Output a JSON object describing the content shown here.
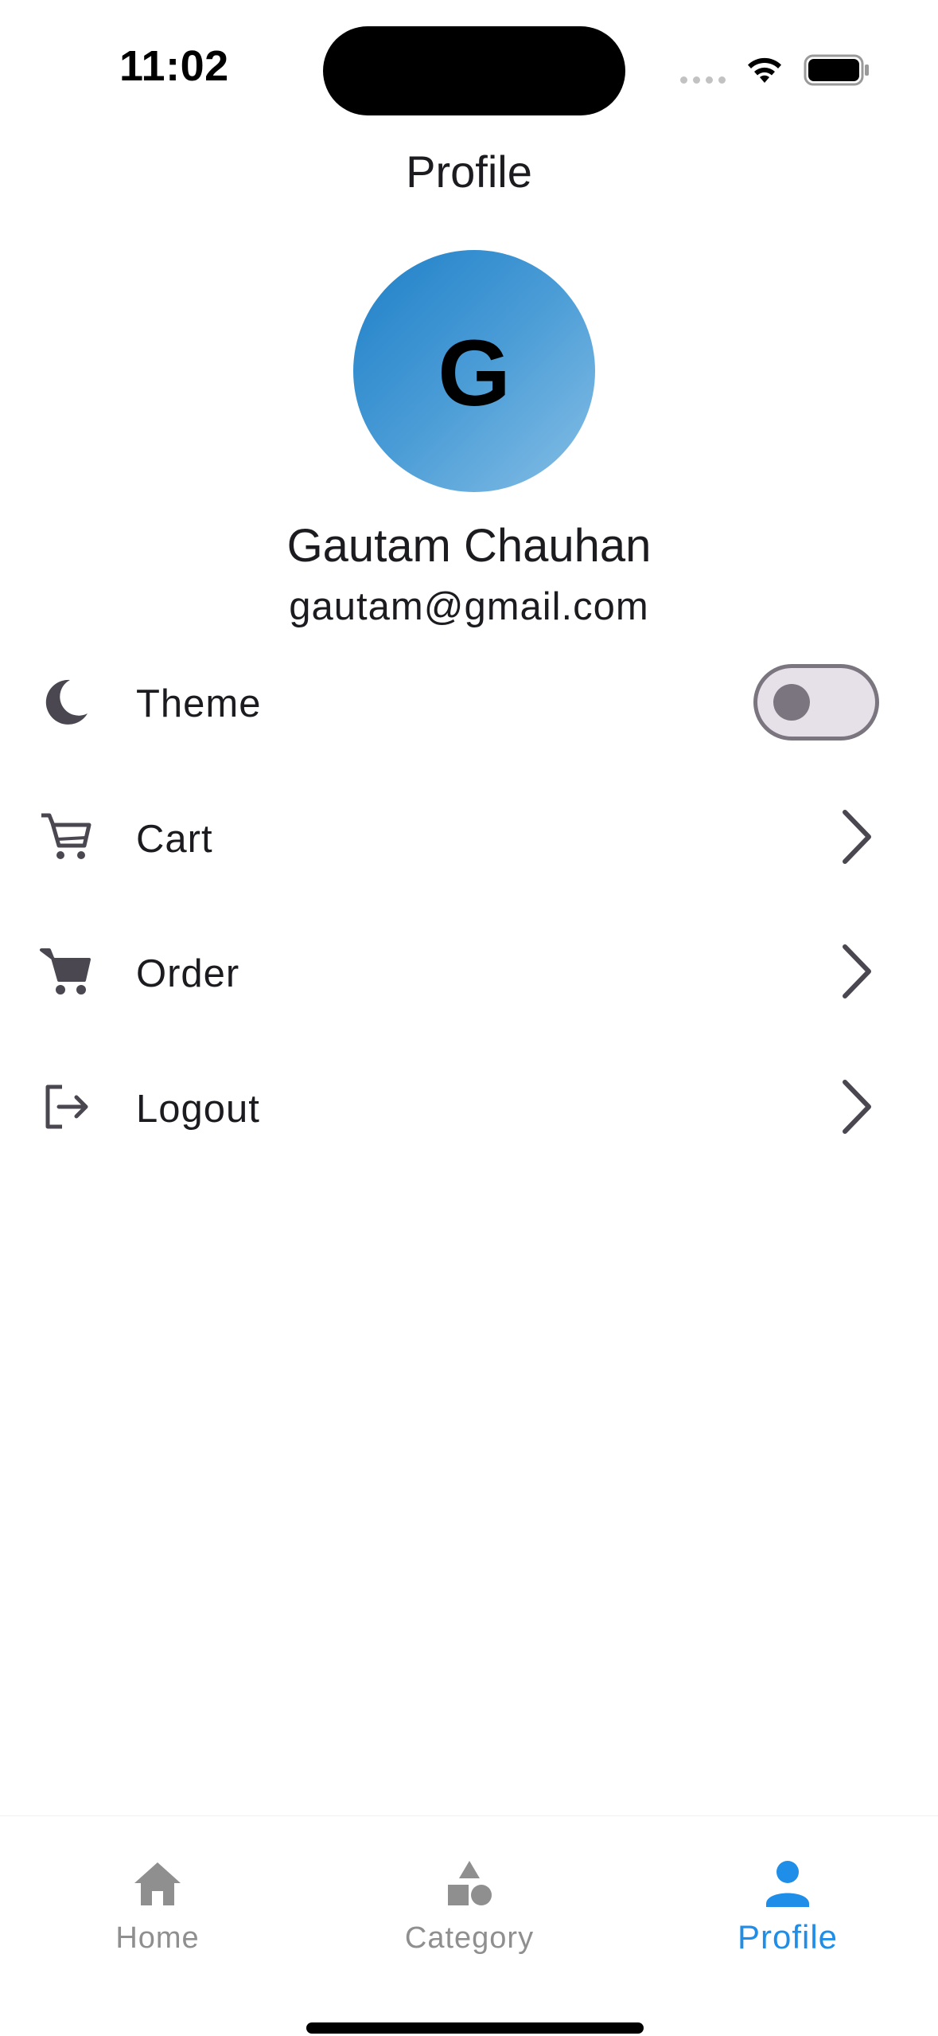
{
  "status_bar": {
    "time": "11:02",
    "icons": [
      "cellular-dots-icon",
      "wifi-icon",
      "battery-icon"
    ]
  },
  "header": {
    "title": "Profile"
  },
  "profile": {
    "avatar_initial": "G",
    "name": "Gautam Chauhan",
    "email": "gautam@gmail.com",
    "avatar_gradient": [
      "#1f80c8",
      "#86bfe6"
    ]
  },
  "menu": {
    "items": [
      {
        "label": "Theme",
        "icon": "moon-icon",
        "control": "toggle",
        "toggle_on": false
      },
      {
        "label": "Cart",
        "icon": "cart-outline-icon",
        "control": "chevron"
      },
      {
        "label": "Order",
        "icon": "cart-filled-icon",
        "control": "chevron"
      },
      {
        "label": "Logout",
        "icon": "logout-icon",
        "control": "chevron"
      }
    ]
  },
  "bottom_nav": {
    "items": [
      {
        "label": "Home",
        "icon": "home-icon",
        "active": false
      },
      {
        "label": "Category",
        "icon": "category-icon",
        "active": false
      },
      {
        "label": "Profile",
        "icon": "person-icon",
        "active": true
      }
    ],
    "active_color": "#1f8ee8",
    "inactive_color": "#8f8f8f"
  }
}
